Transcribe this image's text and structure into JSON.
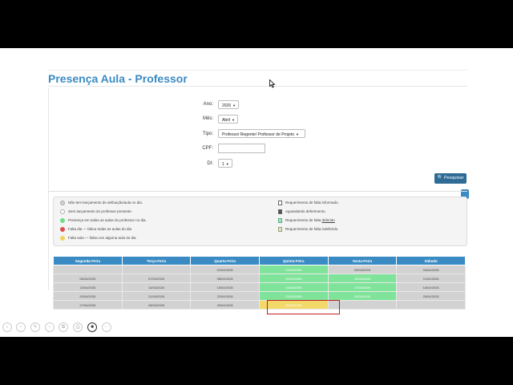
{
  "page": {
    "title": "Presença Aula - Professor"
  },
  "form": {
    "ano_label": "Ano:",
    "ano_value": "2026",
    "mes_label": "Mês:",
    "mes_value": "Abril",
    "tipo_label": "Tipo:",
    "tipo_value": "Professor Regente/ Professor de Projeto",
    "cpf_label": "CPF:",
    "cpf_value": "",
    "di_label": "DI:",
    "di_value": "1",
    "search_label": "Pesquisar"
  },
  "legend": {
    "left": [
      {
        "color": "#d0d0d0",
        "text": "Não tem lançamento de atribuição/aula no dia."
      },
      {
        "color": "#ffffff",
        "text": "Sem lançamento do professor presente."
      },
      {
        "color": "#6fdc8c",
        "text": "Presença em todas as aulas do professor no dia."
      },
      {
        "color": "#e04b4b",
        "text": "Falta dia — faltou todas as aulas do dia"
      },
      {
        "color": "#f2d35a",
        "text": "Falta aula — faltou em alguma aula do dia"
      }
    ],
    "right": [
      {
        "icon": "document-icon",
        "text": "Requerimento de falta informado."
      },
      {
        "icon": "hourglass-icon",
        "text": "Aguardando deferimento."
      },
      {
        "icon": "check-document-icon",
        "text_a": "Requerimento de falta ",
        "text_b": "deferido"
      },
      {
        "icon": "x-document-icon",
        "text": "Requerimento de falta indeferido"
      }
    ]
  },
  "calendar": {
    "headers": [
      "Segunda-Feira",
      "Terça-Feira",
      "Quarta-Feira",
      "Quinta-Feira",
      "Sexta-Feira",
      "Sábado"
    ],
    "rows": [
      [
        {
          "t": "",
          "s": "empty"
        },
        {
          "t": "",
          "s": "empty"
        },
        {
          "t": "01/04/2026",
          "s": "gray"
        },
        {
          "t": "02/04/2026",
          "s": "green"
        },
        {
          "t": "03/04/2026",
          "s": "gray"
        },
        {
          "t": "04/04/2026",
          "s": "gray"
        }
      ],
      [
        {
          "t": "06/04/2026",
          "s": "gray"
        },
        {
          "t": "07/04/2026",
          "s": "gray"
        },
        {
          "t": "08/04/2026",
          "s": "gray"
        },
        {
          "t": "09/04/2026",
          "s": "green"
        },
        {
          "t": "10/04/2026",
          "s": "green"
        },
        {
          "t": "11/04/2026",
          "s": "gray"
        }
      ],
      [
        {
          "t": "13/04/2026",
          "s": "gray"
        },
        {
          "t": "14/04/2026",
          "s": "gray"
        },
        {
          "t": "15/04/2026",
          "s": "gray"
        },
        {
          "t": "16/04/2026",
          "s": "green"
        },
        {
          "t": "17/04/2026",
          "s": "green"
        },
        {
          "t": "18/04/2026",
          "s": "gray"
        }
      ],
      [
        {
          "t": "20/04/2026",
          "s": "gray"
        },
        {
          "t": "21/04/2026",
          "s": "gray"
        },
        {
          "t": "22/04/2026",
          "s": "gray"
        },
        {
          "t": "23/04/2026",
          "s": "green"
        },
        {
          "t": "24/04/2026",
          "s": "green"
        },
        {
          "t": "25/04/2026",
          "s": "gray"
        }
      ],
      [
        {
          "t": "27/04/2026",
          "s": "gray"
        },
        {
          "t": "28/04/2026",
          "s": "gray"
        },
        {
          "t": "29/04/2026",
          "s": "gray"
        },
        {
          "t": "30/04/2026",
          "s": "yellow"
        },
        {
          "t": "",
          "s": "empty"
        },
        {
          "t": "",
          "s": "empty"
        }
      ]
    ]
  },
  "colors": {
    "accent": "#3a8bc3",
    "button": "#2e6c97",
    "green": "#7fe39a",
    "yellow": "#f2d96a",
    "highlight": "#c0201e"
  },
  "toolbar": {
    "icons": [
      "back-icon",
      "forward-icon",
      "pen-icon",
      "eraser-icon",
      "copy-icon",
      "print-icon",
      "camera-icon",
      "more-icon"
    ]
  }
}
